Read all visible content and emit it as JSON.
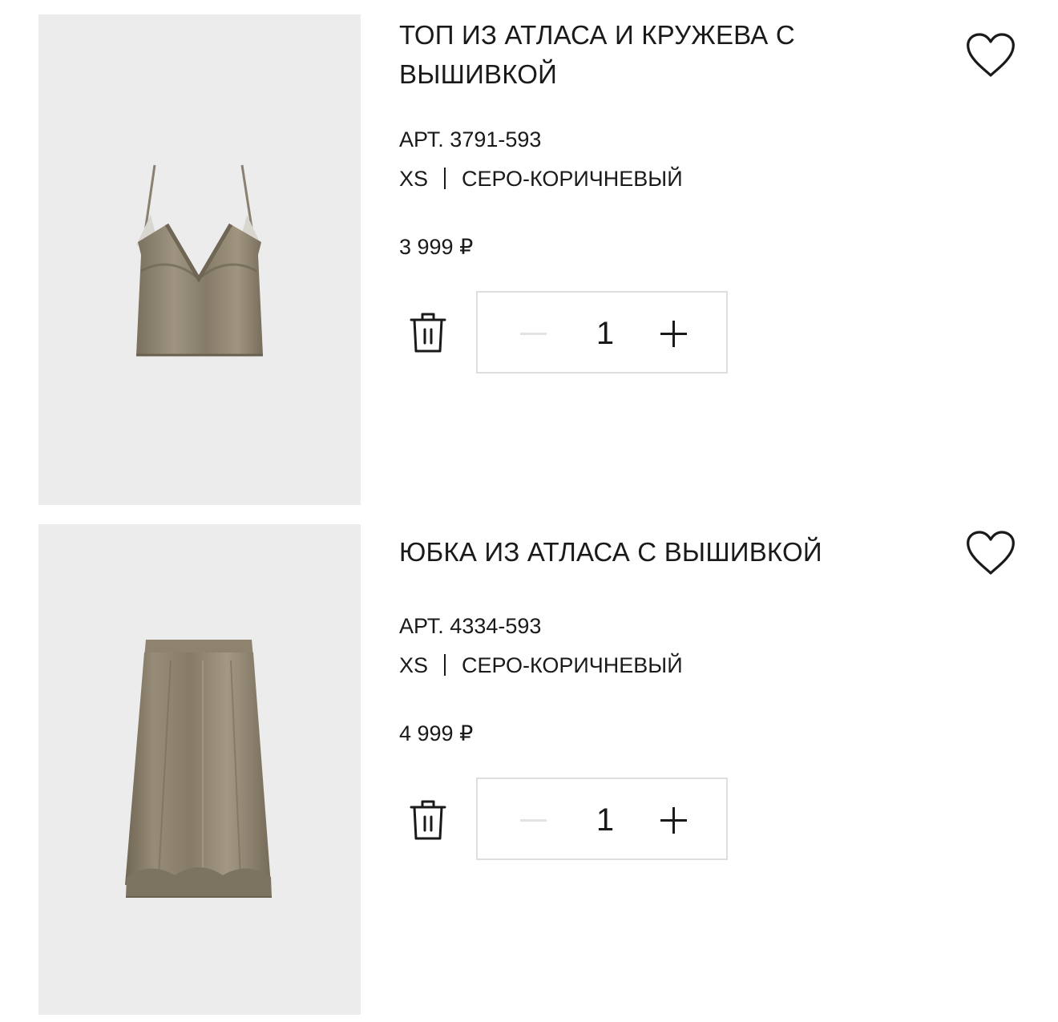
{
  "cart": {
    "items": [
      {
        "title": "ТОП ИЗ АТЛАСА И КРУЖЕВА С ВЫШИВКОЙ",
        "article": "АРТ. 3791-593",
        "size": "XS",
        "color": "СЕРО-КОРИЧНЕВЫЙ",
        "price": "3 999 ₽",
        "quantity": "1",
        "image_icon": "satin-camisole-image"
      },
      {
        "title": "ЮБКА ИЗ АТЛАСА С ВЫШИВКОЙ",
        "article": "АРТ. 4334-593",
        "size": "XS",
        "color": "СЕРО-КОРИЧНЕВЫЙ",
        "price": "4 999 ₽",
        "quantity": "1",
        "image_icon": "satin-skirt-image"
      }
    ]
  },
  "icons": {
    "delete": "trash-icon",
    "minus": "minus-icon",
    "plus": "plus-icon",
    "wishlist": "heart-outline-icon"
  },
  "colors": {
    "text": "#1a1a1a",
    "image_background": "#ececec",
    "stepper_border": "#dedede",
    "disabled_minus": "#e3e3e3",
    "fabric": "#8c826f"
  }
}
